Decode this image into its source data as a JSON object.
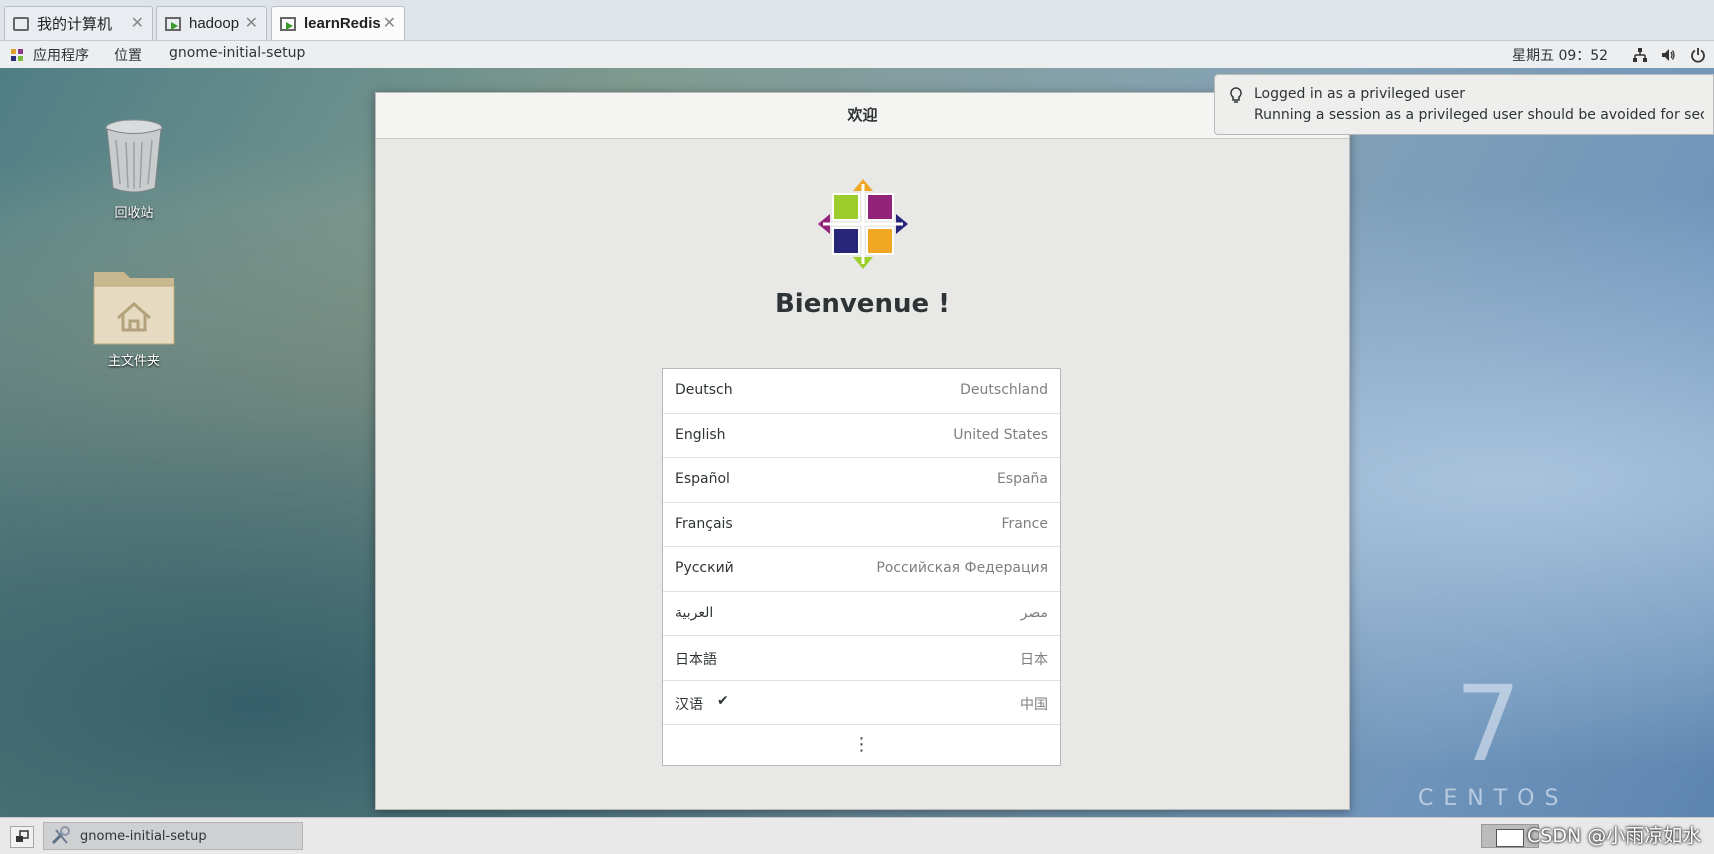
{
  "vm_tabs": [
    {
      "label": "我的计算机",
      "icon": "monitor-icon"
    },
    {
      "label": "hadoop",
      "icon": "vm-icon"
    },
    {
      "label": "learnRedis",
      "icon": "vm-icon",
      "active": true
    }
  ],
  "topbar": {
    "applications": "应用程序",
    "places": "位置",
    "active_app": "gnome-initial-setup",
    "clock": "星期五 09：52"
  },
  "desktop_icons": [
    {
      "label": "回收站",
      "icon": "trash-icon"
    },
    {
      "label": "主文件夹",
      "icon": "home-folder-icon"
    }
  ],
  "notification": {
    "title": "Logged in as a privileged user",
    "body": "Running a session as a privileged user should be avoided for securit…"
  },
  "dialog": {
    "header": "欢迎",
    "welcome": "Bienvenue !",
    "languages": [
      {
        "name": "Deutsch",
        "region": "Deutschland"
      },
      {
        "name": "English",
        "region": "United States"
      },
      {
        "name": "Español",
        "region": "España"
      },
      {
        "name": "Français",
        "region": "France"
      },
      {
        "name": "Русский",
        "region": "Российская Федерация"
      },
      {
        "name": "العربية",
        "region": "مصر"
      },
      {
        "name": "日本語",
        "region": "日本"
      },
      {
        "name": "汉语",
        "region": "中国",
        "selected": true
      }
    ],
    "check_mark": "✔",
    "more": "⋮"
  },
  "watermark_brand": {
    "seven": "7",
    "name": "CENTOS"
  },
  "taskbar": {
    "task_label": "gnome-initial-setup"
  },
  "csdn_watermark": "CSDN @小雨凉如水"
}
